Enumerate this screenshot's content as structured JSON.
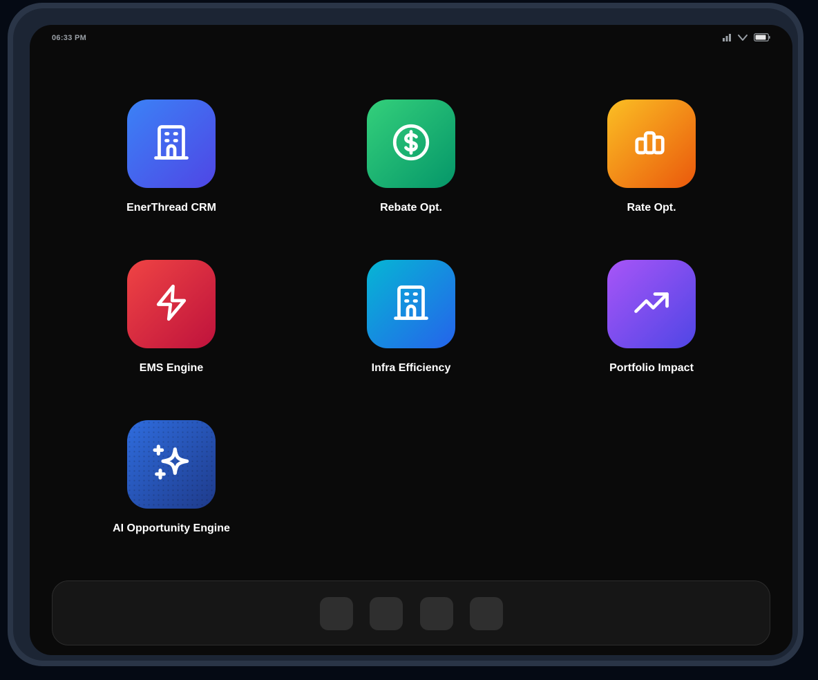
{
  "status_bar": {
    "time": "06:33 PM",
    "icons": [
      "signal-icon",
      "wifi-icon",
      "battery-icon"
    ]
  },
  "apps": [
    {
      "label": "EnerThread CRM",
      "icon": "building-icon",
      "gradient": [
        "#3b82f6",
        "#4f46e5"
      ]
    },
    {
      "label": "Rebate Opt.",
      "icon": "dollar-circle-icon",
      "gradient": [
        "#34d07b",
        "#059669"
      ]
    },
    {
      "label": "Rate Opt.",
      "icon": "bar-chart-icon",
      "gradient": [
        "#fbbf24",
        "#ea580c"
      ]
    },
    {
      "label": "EMS Engine",
      "icon": "lightning-icon",
      "gradient": [
        "#ef4444",
        "#be123c"
      ]
    },
    {
      "label": "Infra Efficiency",
      "icon": "building-icon",
      "gradient": [
        "#06b6d4",
        "#2563eb"
      ]
    },
    {
      "label": "Portfolio Impact",
      "icon": "trending-up-icon",
      "gradient": [
        "#a855f7",
        "#4f46e5"
      ]
    },
    {
      "label": "AI Opportunity Engine",
      "icon": "sparkles-icon",
      "gradient": [
        "#2f6ddf",
        "#1e3a8a"
      ]
    }
  ],
  "dock": {
    "slots": 4,
    "slot_color": "#2f2f2f"
  }
}
